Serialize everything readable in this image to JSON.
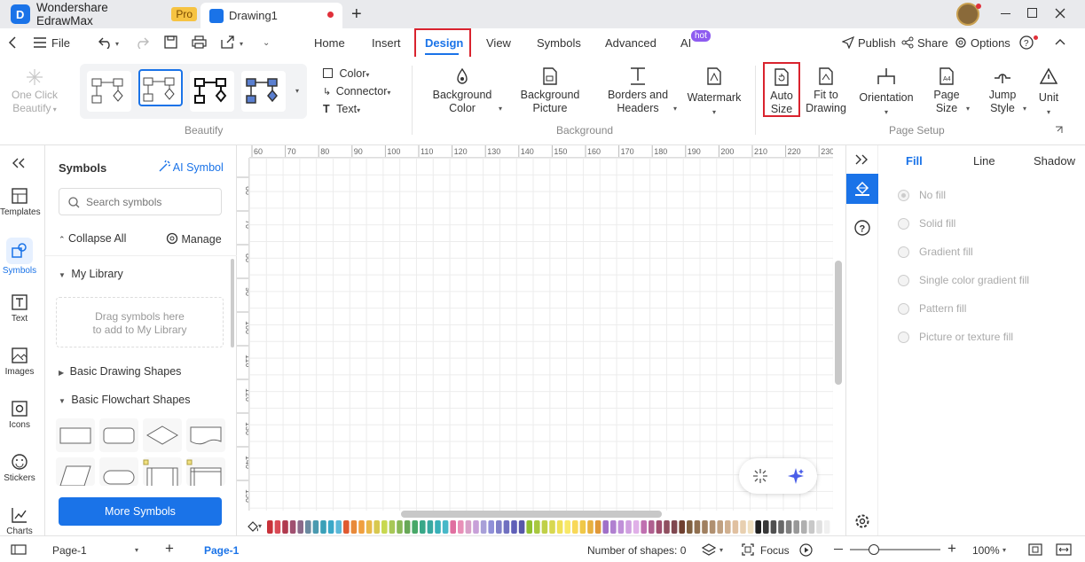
{
  "titlebar": {
    "app_name": "Wondershare EdrawMax",
    "app_badge": "Pro",
    "doc_tab": "Drawing1"
  },
  "menubar": {
    "file_label": "File",
    "tabs": [
      "Home",
      "Insert",
      "Design",
      "View",
      "Symbols",
      "Advanced",
      "AI"
    ],
    "active_tab": "Design",
    "ai_badge": "hot",
    "publish": "Publish",
    "share": "Share",
    "options": "Options"
  },
  "ribbon": {
    "one_click_beautify": [
      "One Click",
      "Beautify"
    ],
    "beautify_group": "Beautify",
    "color": "Color",
    "connector": "Connector",
    "text": "Text",
    "background_color": [
      "Background",
      "Color"
    ],
    "background_picture": [
      "Background",
      "Picture"
    ],
    "borders_headers": [
      "Borders and",
      "Headers"
    ],
    "watermark": "Watermark",
    "background_group": "Background",
    "auto_size": [
      "Auto",
      "Size"
    ],
    "fit_to_drawing": [
      "Fit to",
      "Drawing"
    ],
    "orientation": "Orientation",
    "page_size": [
      "Page",
      "Size"
    ],
    "jump_style": [
      "Jump",
      "Style"
    ],
    "unit": "Unit",
    "page_setup_group": "Page Setup"
  },
  "rail": {
    "items": [
      "Templates",
      "Symbols",
      "Text",
      "Images",
      "Icons",
      "Stickers",
      "Charts"
    ],
    "active": "Symbols"
  },
  "symbols_panel": {
    "title": "Symbols",
    "ai_symbol": "AI Symbol",
    "search_placeholder": "Search symbols",
    "collapse_all": "Collapse All",
    "manage": "Manage",
    "my_library": "My Library",
    "library_hint": [
      "Drag symbols here",
      "to add to My Library"
    ],
    "basic_drawing": "Basic Drawing Shapes",
    "basic_flowchart": "Basic Flowchart Shapes",
    "more_symbols": "More Symbols"
  },
  "canvas": {
    "h_ruler": [
      "60",
      "70",
      "80",
      "90",
      "100",
      "110",
      "120",
      "130",
      "140",
      "150",
      "160",
      "170",
      "180",
      "190",
      "200",
      "210",
      "220",
      "230"
    ],
    "v_ruler": [
      "60",
      "70",
      "80",
      "90",
      "100",
      "110",
      "120",
      "130",
      "140",
      "150"
    ]
  },
  "right_panel": {
    "tabs": [
      "Fill",
      "Line",
      "Shadow"
    ],
    "active_tab": "Fill",
    "fill_options": [
      "No fill",
      "Solid fill",
      "Gradient fill",
      "Single color gradient fill",
      "Pattern fill",
      "Picture or texture fill"
    ]
  },
  "statusbar": {
    "page_select": "Page-1",
    "page_tab": "Page-1",
    "shape_count": "Number of shapes: 0",
    "focus": "Focus",
    "zoom": "100%"
  },
  "colors": {
    "accent": "#1a73e8",
    "highlight_red": "#d9232e",
    "more_symbols_bg": "#1a73e8"
  },
  "palette": [
    "#c8323a",
    "#d94a55",
    "#b03a4e",
    "#a05070",
    "#8a6a8a",
    "#6a8aa0",
    "#4a9ab0",
    "#3aa0b8",
    "#3aa8c8",
    "#5ab8d8",
    "#e05a30",
    "#e88a3a",
    "#f0a040",
    "#e8b84a",
    "#d8c850",
    "#c8d850",
    "#a8c858",
    "#88b858",
    "#68a858",
    "#48a868",
    "#38a888",
    "#38a8a0",
    "#38b0b8",
    "#48b8c8",
    "#e070a0",
    "#e890b8",
    "#d8a0c8",
    "#c8a0d8",
    "#a8a0d8",
    "#9090d8",
    "#8080c8",
    "#7070c0",
    "#6060b8",
    "#5858a8",
    "#90c030",
    "#a8c840",
    "#c0d048",
    "#d8d850",
    "#f0e058",
    "#f8e868",
    "#f8d858",
    "#f0c848",
    "#e8b040",
    "#e09838",
    "#a070c8",
    "#b080d0",
    "#c090d8",
    "#d0a0e0",
    "#e0b0e8",
    "#c070b0",
    "#b06090",
    "#a05070",
    "#905060",
    "#804850",
    "#704030",
    "#806040",
    "#907050",
    "#a08060",
    "#b09070",
    "#c0a080",
    "#d0b090",
    "#e0c0a0",
    "#e8d0b0",
    "#f0e0c0",
    "#202020",
    "#383838",
    "#505050",
    "#686868",
    "#808080",
    "#989898",
    "#b0b0b0",
    "#c8c8c8",
    "#e0e0e0",
    "#f0f0f0"
  ]
}
